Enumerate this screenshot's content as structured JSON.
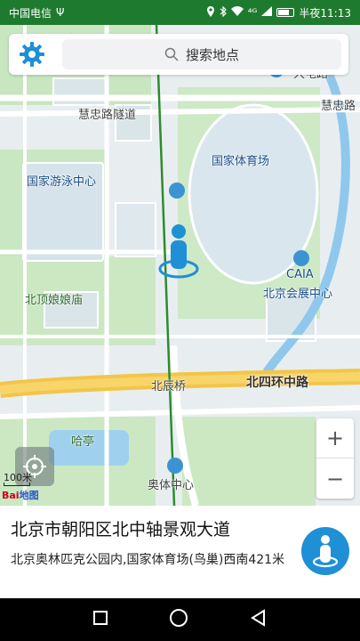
{
  "status_bar": {
    "carrier": "中国电信",
    "usb": "Ψ",
    "signal": "⁴ᴳ",
    "time": "半夜11:13"
  },
  "search": {
    "placeholder": "搜索地点"
  },
  "map": {
    "labels": {
      "huizhong_tunnel": "慧忠路隧道",
      "huizhong_road": "慧忠路",
      "stadium": "国家体育场",
      "aquatics": "国家游泳中心",
      "caia": "CAIA",
      "convention": "北京会展中心",
      "niangniang": "北顶娘娘庙",
      "beichen_bridge": "北辰桥",
      "fourth_ring": "北四环中路",
      "hating": "哈亭",
      "olympic_center": "奥体中心",
      "datun": "大屯路"
    },
    "scale_label": "100米",
    "logo_text": "Bai",
    "logo_suffix": "地图"
  },
  "zoom": {
    "in_label": "+",
    "out_label": "−"
  },
  "info": {
    "title": "北京市朝阳区北中轴景观大道",
    "description": "北京奥林匹克公园内,国家体育场(鸟巢)西南421米"
  },
  "colors": {
    "status_bar": "#1e7a2e",
    "accent": "#1f8fd6",
    "axis_line": "#2e8b2e",
    "ring_road": "#f3c548"
  }
}
